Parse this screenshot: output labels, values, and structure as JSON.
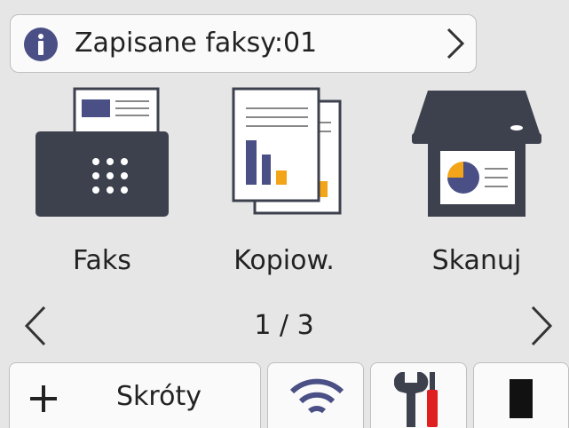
{
  "notification": {
    "text": "Zapisane faksy:01",
    "icon": "info-icon",
    "arrow": "chevron-right-icon"
  },
  "apps": [
    {
      "label": "Faks",
      "icon": "fax-icon"
    },
    {
      "label": "Kopiow.",
      "icon": "copy-icon"
    },
    {
      "label": "Skanuj",
      "icon": "scan-icon"
    }
  ],
  "pager": {
    "text": "1 / 3"
  },
  "bottom": {
    "shortcuts_label": "Skróty",
    "buttons": [
      "plus-icon",
      "wifi-icon",
      "tools-icon",
      "toner-icon"
    ]
  },
  "colors": {
    "accent": "#4a4f86",
    "dark": "#3d414d",
    "orange": "#f3a51a",
    "red": "#e02020"
  }
}
